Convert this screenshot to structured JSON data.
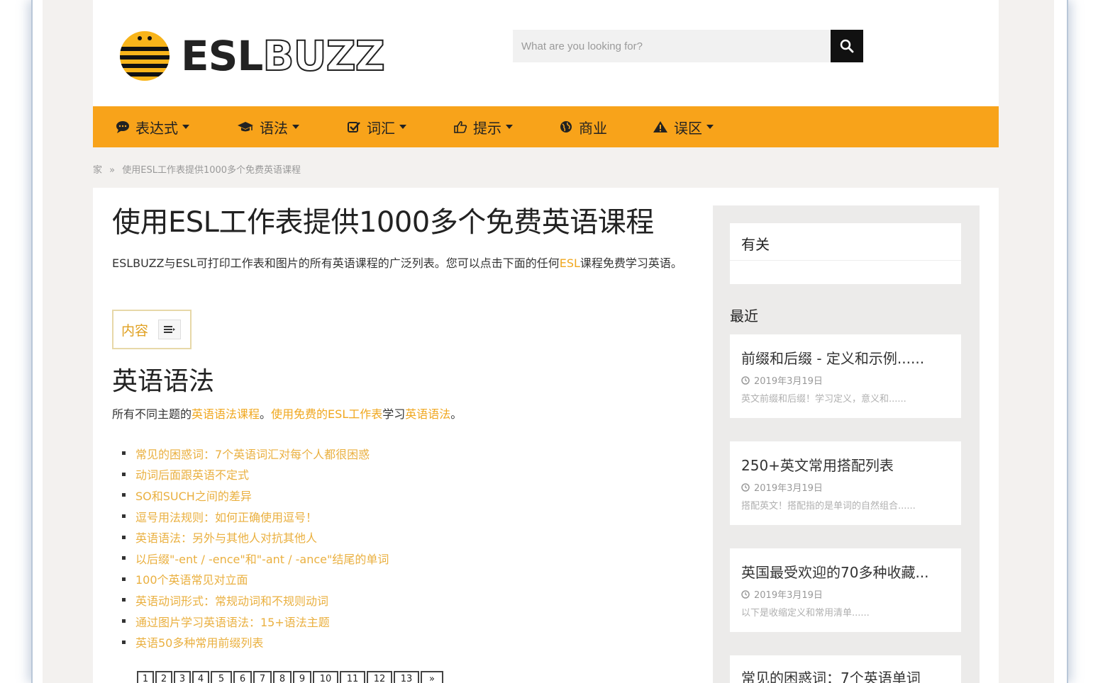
{
  "header": {
    "logo_bold": "ESL",
    "logo_outline": "BUZZ",
    "search_placeholder": "What are you looking for?"
  },
  "nav": [
    {
      "label": "表达式",
      "icon": "comment-icon",
      "dropdown": true
    },
    {
      "label": "语法",
      "icon": "graduation-cap-icon",
      "dropdown": true
    },
    {
      "label": "词汇",
      "icon": "check-square-icon",
      "dropdown": true
    },
    {
      "label": "提示",
      "icon": "thumbs-up-icon",
      "dropdown": true
    },
    {
      "label": "商业",
      "icon": "globe-icon",
      "dropdown": false
    },
    {
      "label": "误区",
      "icon": "warning-icon",
      "dropdown": true
    }
  ],
  "breadcrumb": {
    "home": "家",
    "separator": "»",
    "current": "使用ESL工作表提供1000多个免费英语课程"
  },
  "article": {
    "title": "使用ESL工作表提供1000多个免费英语课程",
    "intro_before": "ESLBUZZ与ESL可打印工作表和图片的所有英语课程的广泛列表。您可以点击下面的任何",
    "intro_link": "ESL",
    "intro_after": "课程免费学习英语。",
    "toc_label": "内容",
    "section_title": "英语语法",
    "section_intro": {
      "t1": "所有不同主题的",
      "l1": "英语语法课程",
      "t2": "。",
      "l2": "使用免费的ESL工作表",
      "t3": "学习",
      "l3": "英语语法",
      "t4": "。"
    },
    "links": [
      "常见的困惑词：7个英语词汇对每个人都很困惑",
      "动词后面跟英语不定式",
      "SO和SUCH之间的差异",
      "逗号用法规则：如何正确使用逗号！",
      "英语语法：另外与其他人对抗其他人",
      "以后缀\"-ent / -ence\"和\"-ant / -ance\"结尾的单词",
      "100个英语常见对立面",
      "英语动词形式：常规动词和不规则动词",
      "通过图片学习英语语法：15+语法主题",
      "英语50多种常用前缀列表"
    ],
    "pages": [
      "1",
      "2",
      "3",
      "4",
      "5",
      "6",
      "7",
      "8",
      "9",
      "10",
      "11",
      "12",
      "13",
      "»"
    ]
  },
  "sidebar": {
    "about_title": "有关",
    "recent_label": "最近",
    "posts": [
      {
        "title": "前缀和后缀 - 定义和示例......",
        "date": "2019年3月19日",
        "excerpt": "英文前缀和后缀！学习定义，意义和......"
      },
      {
        "title": "250+英文常用搭配列表",
        "date": "2019年3月19日",
        "excerpt": "搭配英文！搭配指的是单词的自然组合......"
      },
      {
        "title": "英国最受欢迎的70多种收藏...",
        "date": "2019年3月19日",
        "excerpt": "以下是收缩定义和常用清单......"
      },
      {
        "title": "常见的困惑词：7个英语单词",
        "date": "",
        "excerpt": ""
      }
    ]
  },
  "colors": {
    "accent": "#f8a31a",
    "link": "#f0a71e",
    "background": "#f3f1ef"
  }
}
